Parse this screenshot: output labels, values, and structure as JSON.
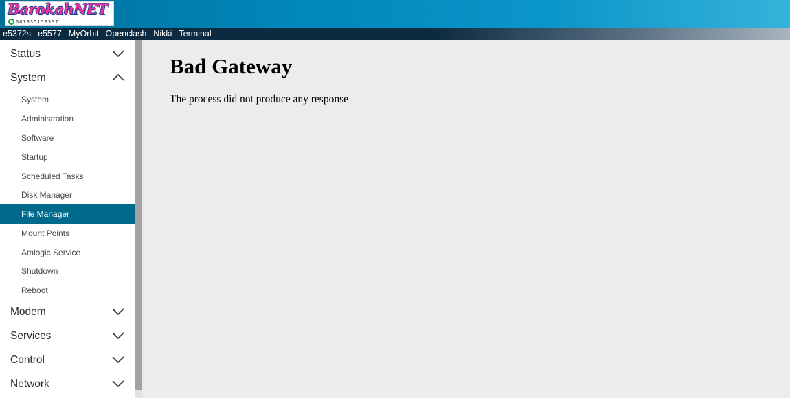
{
  "header": {
    "logo_text": "BarokahNET",
    "logo_phone": "081335153337",
    "logo_icon": "whatsapp-icon"
  },
  "topnav": {
    "links": [
      "e5372s",
      "e5577",
      "MyOrbit",
      "Openclash",
      "Nikki",
      "Terminal"
    ]
  },
  "sidebar": {
    "categories": [
      {
        "label": "Status",
        "expanded": false
      },
      {
        "label": "System",
        "expanded": true
      },
      {
        "label": "Modem",
        "expanded": false
      },
      {
        "label": "Services",
        "expanded": false
      },
      {
        "label": "Control",
        "expanded": false
      },
      {
        "label": "Network",
        "expanded": false
      }
    ],
    "system_items": [
      "System",
      "Administration",
      "Software",
      "Startup",
      "Scheduled Tasks",
      "Disk Manager",
      "File Manager",
      "Mount Points",
      "Amlogic Service",
      "Shutdown",
      "Reboot"
    ],
    "active_item": "File Manager"
  },
  "main": {
    "heading": "Bad Gateway",
    "message": "The process did not produce any response"
  },
  "colors": {
    "header_accent": "#0086b8",
    "topnav_bg": "#0c2a40",
    "active_item_bg": "#006a8c",
    "content_bg": "#ececec"
  }
}
